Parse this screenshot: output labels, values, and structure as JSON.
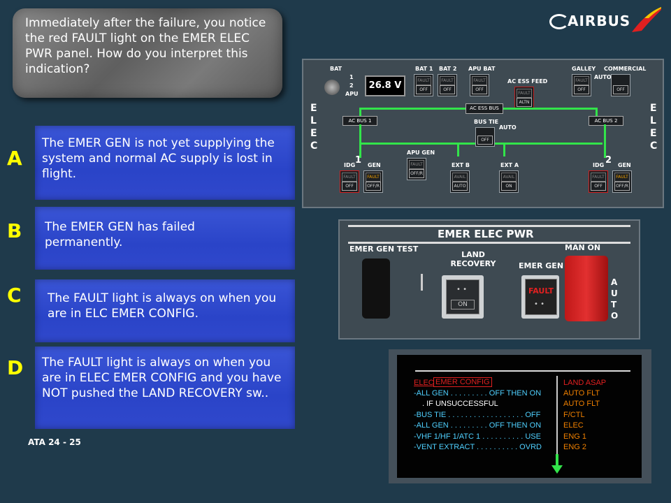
{
  "question": "Immediately after the failure, you notice the red FAULT light on the EMER ELEC PWR panel. How do you interpret this indication?",
  "logo": {
    "text": "AIRBUS"
  },
  "answers": [
    {
      "letter": "A",
      "text": "The EMER GEN is not yet supplying the system and normal AC supply is lost in flight."
    },
    {
      "letter": "B",
      "text": "The EMER GEN has failed permanently."
    },
    {
      "letter": "C",
      "text": "The FAULT light is always on when you are in ELC EMER CONFIG."
    },
    {
      "letter": "D",
      "text": "The FAULT light is always on when you are in ELEC EMER CONFIG and you have NOT pushed the LAND RECOVERY sw.."
    }
  ],
  "footer": "ATA 24 - 25",
  "elec_panel": {
    "bat": "BAT",
    "bat_pos": [
      "1",
      "2",
      "APU"
    ],
    "bat_display": "26.8 V",
    "bat1": "BAT 1",
    "bat2": "BAT 2",
    "apu_bat": "APU BAT",
    "ac_ess_feed": "AC ESS FEED",
    "galley": "GALLEY",
    "commercial": "COMMERCIAL",
    "auto": "AUTO",
    "ac_ess_bus": "AC ESS BUS",
    "ac_bus_1": "AC BUS 1",
    "ac_bus_2": "AC BUS 2",
    "bus_tie": "BUS TIE",
    "apu_gen": "APU GEN",
    "idg": "IDG",
    "gen": "GEN",
    "ext_b": "EXT B",
    "ext_a": "EXT A",
    "side_label": "ELEC",
    "num1": "1",
    "num2": "2",
    "fault": "FAULT",
    "off": "OFF",
    "off_r": "OFF/R",
    "avail": "AVAIL",
    "on": "ON",
    "altn": "ALTN"
  },
  "emer_panel": {
    "title": "EMER ELEC PWR",
    "emer_gen_test": "EMER GEN TEST",
    "land_recovery": "LAND RECOVERY",
    "on": "ON",
    "emer_gen": "EMER GEN",
    "fault": "FAULT",
    "man_on": "MAN ON",
    "auto": "AUTO"
  },
  "ecam": {
    "title1": "ELEC",
    "title2": "EMER CONFIG",
    "lines": [
      "-ALL GEN . . . . . . . . . OFF THEN ON",
      ". IF UNSUCCESSFUL",
      "-BUS TIE . . . . . . . . . . . . . . . . . . OFF",
      "-ALL GEN . . . . . . . . . OFF THEN ON",
      "-VHF 1/HF 1/ATC 1 . . . . . . . . . . USE",
      "-VENT EXTRACT . . . . . . . . . . OVRD"
    ],
    "right": [
      "LAND ASAP",
      "AUTO FLT",
      "AUTO FLT",
      "F/CTL",
      "ELEC",
      "ENG 1",
      "ENG 2"
    ]
  },
  "colors": {
    "accent": "#ffff00",
    "answer_bg": "#2f49cc",
    "fault_red": "#e02020",
    "bus_green": "#32e44a"
  }
}
